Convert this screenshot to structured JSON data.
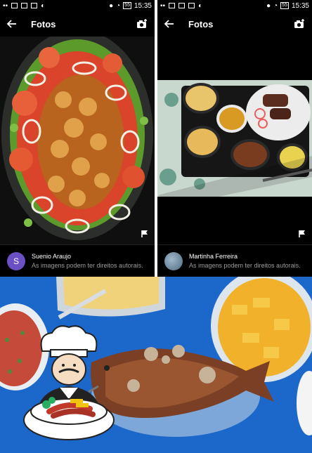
{
  "left_panel": {
    "status": {
      "time": "15:35",
      "battery": "55"
    },
    "title": "Fotos",
    "author": "Suenio Araujo",
    "avatar_letter": "S",
    "rights": "As imagens podem ter direitos autorais."
  },
  "right_panel": {
    "status": {
      "time": "15:35",
      "battery": "55"
    },
    "title": "Fotos",
    "author": "Martinha Ferreira",
    "rights": "As imagens podem ter direitos autorais."
  },
  "colors": {
    "panel_bg": "#000000",
    "left_avatar": "#6b4fc4",
    "tablecloth": "#1e6fd3"
  }
}
